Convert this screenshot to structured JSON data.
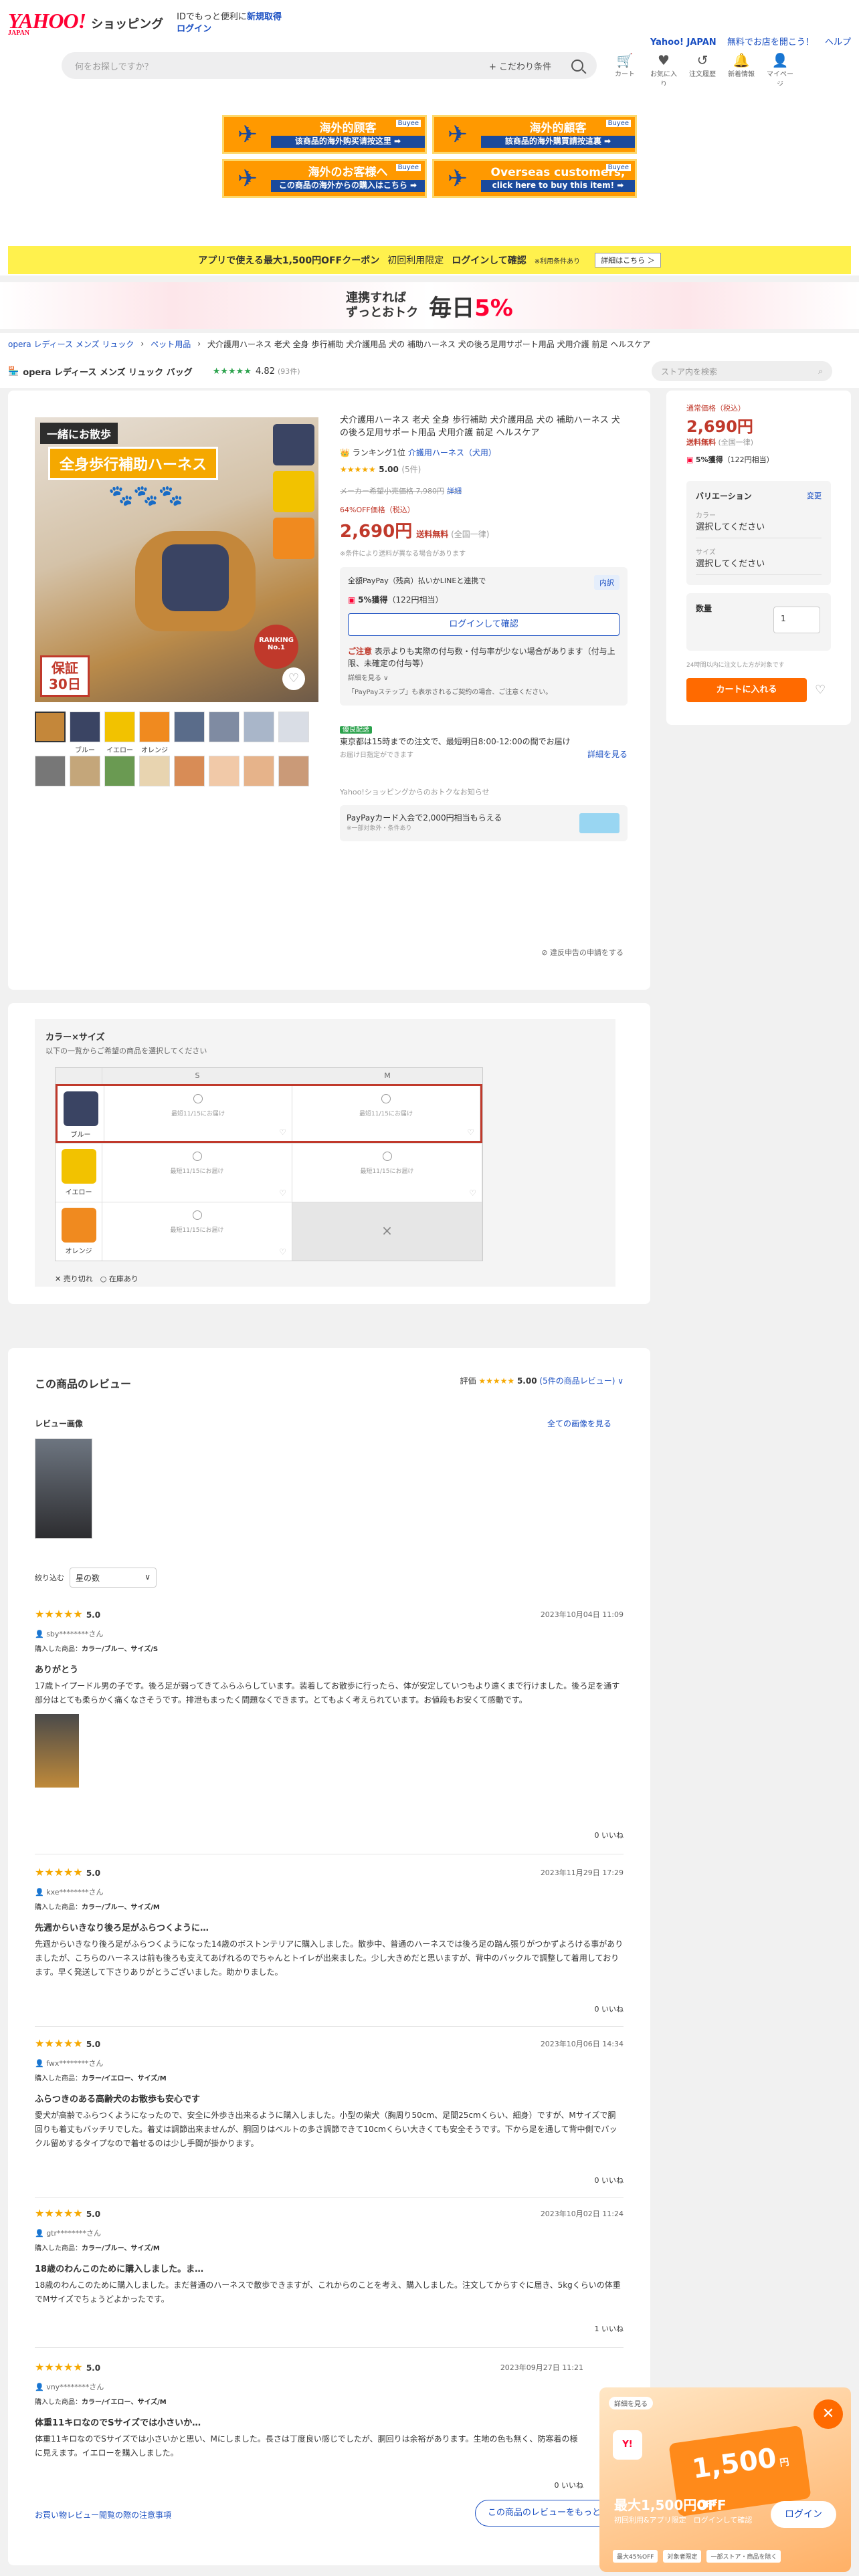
{
  "header": {
    "logo_main": "YAHOO!",
    "logo_sub": "JAPAN",
    "shopping": "ショッピング",
    "promo_line1": "IDでもっと便利に",
    "promo_link": "新規取得",
    "promo_login": "ログイン",
    "right_brand": "Yahoo! JAPAN",
    "right_link1": "無料でお店を開こう！",
    "right_link2": "ヘルプ",
    "search_placeholder": "何をお探しですか？",
    "search_filter": "+ こだわり条件",
    "icons": [
      {
        "icon": "cart-icon",
        "label": "カート"
      },
      {
        "icon": "heart-icon",
        "label": "お気に入り"
      },
      {
        "icon": "history-icon",
        "label": "注文履歴"
      },
      {
        "icon": "bell-icon",
        "label": "新着情報"
      },
      {
        "icon": "user-icon",
        "label": "マイページ"
      }
    ]
  },
  "ads": [
    {
      "t1": "海外的顾客",
      "t2": "该商品的海外购买请按这里 ➡",
      "badge": "Buyee"
    },
    {
      "t1": "海外的顧客",
      "t2": "該商品的海外購買請按這裏 ➡",
      "badge": "Buyee"
    },
    {
      "t1": "海外のお客様へ",
      "t2": "この商品の海外からの購入はこちら ➡",
      "badge": "Buyee"
    },
    {
      "t1": "Overseas customers,",
      "t2": "click here to buy this item! ➡",
      "badge": "Buyee"
    }
  ],
  "coupon": {
    "text1": "アプリで使える最大1,500円OFFクーポン",
    "text2": "初回利用限定",
    "text3": "ログインして確認",
    "small": "※利用条件あり",
    "btn": "詳細はこちら ＞"
  },
  "banner": {
    "txt1": "連携すれば",
    "txt2": "ずっとおトク",
    "big1": "毎日",
    "big2": "5%"
  },
  "breadcrumb": [
    "opera レディース メンズ リュック",
    "ペット用品",
    "犬介護用ハーネス 老犬 全身 歩行補助 犬介護用品 犬の 補助ハーネス 犬の後ろ足用サポート用品 犬用介護 前足 ヘルスケア"
  ],
  "store": {
    "name": "opera レディース メンズ リュック バッグ",
    "stars": "★★★★★",
    "rating": "4.82",
    "count": "(93件)",
    "search_placeholder": "ストア内を検索"
  },
  "product": {
    "image_banner1": "一緒にお散歩",
    "image_banner2": "全身歩行補助ハーネス",
    "image_paws": "🐾🐾🐾",
    "image_guarantee": "保証\n30日",
    "image_ranking": "RANKING\nNo.1",
    "thumb_labels": [
      "",
      "ブルー",
      "イエロー",
      "オレンジ"
    ],
    "title": "犬介護用ハーネス 老犬 全身 歩行補助 犬介護用品 犬の 補助ハーネス 犬の後ろ足用サポート用品 犬用介護 前足 ヘルスケア",
    "rank_text": "ランキング1位",
    "rank_link": "介護用ハーネス（犬用）",
    "stars": "★★★★★",
    "rating": "5.00",
    "review_count": "(5件)",
    "strike_price": "メーカー希望小売価格 7,980円",
    "strike_link": "詳細",
    "off": "64%OFF価格（税込）",
    "price": "2,690円",
    "price_ship": "送料無料",
    "price_ship_note": "(全国一律)",
    "note": "※条件により送料が異なる場合があります",
    "pay_line": "全額PayPay（残高）払いかLINEと連携で",
    "pay_naiyaku": "内訳",
    "pay_points": "5%獲得",
    "pay_points_sub": "（122円相当）",
    "login_btn": "ログインして確認",
    "caution_head": "ご注意",
    "caution": "表示よりも実際の付与数・付与率が少ない場合があります（付与上限、未確定の付与等）",
    "caution_more": "詳細を見る ∨",
    "caution_small": "「PayPayステップ」も表示されるご契約の場合、ご注意ください。",
    "ship_tag": "優良配送",
    "ship_line": "東京都は15時までの注文で、最短明日8:00-12:00の間でお届け",
    "ship_sub": "お届け日指定ができます",
    "ship_link": "詳細を見る",
    "pp_head": "Yahoo!ショッピングからのおトクなお知らせ",
    "pp_line": "PayPayカード入会で2,000円相当もらえる",
    "pp_sub": "※一部対象外・条件あり",
    "report": "⊘ 違反申告の申請をする"
  },
  "side": {
    "label": "通常価格（税込）",
    "price": "2,690円",
    "ship": "送料無料",
    "ship_note": "(全国一律)",
    "points": "5%獲得",
    "points_sub": "（122円相当）",
    "var_title": "バリエーション",
    "var_change": "変更",
    "k1": "カラー",
    "v1": "選択してください",
    "k2": "サイズ",
    "v2": "選択してください",
    "qty_label": "数量",
    "qty_value": "1",
    "small": "24時間以内に注文した方が対象です",
    "cart": "カートに入れる"
  },
  "colorsize": {
    "title": "カラー×サイズ",
    "sub": "以下の一覧からご希望の商品を選択してください",
    "sizes": [
      "S",
      "M"
    ],
    "rows": [
      {
        "color": "ブルー",
        "cells": [
          "最短11/15にお届け",
          "最短11/15にお届け"
        ]
      },
      {
        "color": "イエロー",
        "cells": [
          "最短11/15にお届け",
          "最短11/15にお届け"
        ]
      },
      {
        "color": "オレンジ",
        "cells": [
          "最短11/15にお届け",
          "×"
        ]
      }
    ],
    "legend1": "✕ 売り切れ",
    "legend2": "○ 在庫あり"
  },
  "reviews": {
    "title": "この商品のレビュー",
    "score_label": "評価",
    "score_stars": "★★★★★",
    "score": "5.00",
    "score_link": "(5件の商品レビュー) ∨",
    "images_label": "レビュー画像",
    "all_images": "全ての画像を見る",
    "filter_label": "絞り込む",
    "filter_value": "星の数",
    "items": [
      {
        "stars": "★★★★★",
        "score": "5.0",
        "date": "2023年10月04日 11:09",
        "user": "sby********さん",
        "bought_label": "購入した商品：",
        "bought": "カラー/ブルー、サイズ/S",
        "title": "ありがとう",
        "body": "17歳トイプードル男の子です。後ろ足が弱ってきてふらふらしています。装着してお散歩に行ったら、体が安定していつもより遠くまで行けました。後ろ足を通す部分はとても柔らかく痛くなさそうです。排泄もまったく問題なくできます。とてもよく考えられています。お値段もお安くて感動です。",
        "likes": "0 いいね"
      },
      {
        "stars": "★★★★★",
        "score": "5.0",
        "date": "2023年11月29日 17:29",
        "user": "kxe********さん",
        "bought_label": "購入した商品：",
        "bought": "カラー/ブルー、サイズ/M",
        "title": "先週からいきなり後ろ足がふらつくように…",
        "body": "先週からいきなり後ろ足がふらつくようになった14歳のボストンテリアに購入しました。散歩中、普通のハーネスでは後ろ足の踏ん張りがつかずよろける事がありましたが、こちらのハーネスは前も後ろも支えてあげれるのでちゃんとトイレが出来ました。少し大きめだと思いますが、背中のバックルで調整して着用しております。早く発送して下さりありがとうございました。助かりました。",
        "likes": "0 いいね"
      },
      {
        "stars": "★★★★★",
        "score": "5.0",
        "date": "2023年10月06日 14:34",
        "user": "fwx********さん",
        "bought_label": "購入した商品：",
        "bought": "カラー/イエロー、サイズ/M",
        "title": "ふらつきのある高齢犬のお散歩も安心です",
        "body": "愛犬が高齢でふらつくようになったので、安全に外歩き出来るように購入しました。小型の柴犬（胸周り50cm、足間25cmくらい、細身）ですが、Mサイズで胴回りも着丈もバッチリでした。着丈は調節出来ませんが、胴回りはベルトの多さ調節できて10cmくらい大きくても安全そうです。下から足を通して背中側でバックル留めするタイプなので着せるのは少し手間が掛かります。",
        "likes": "0 いいね"
      },
      {
        "stars": "★★★★★",
        "score": "5.0",
        "date": "2023年10月02日 11:24",
        "user": "gtr********さん",
        "bought_label": "購入した商品：",
        "bought": "カラー/ブルー、サイズ/M",
        "title": "18歳のわんこのために購入しました。ま…",
        "body": "18歳のわんこのために購入しました。まだ普通のハーネスで散歩できますが、これからのことを考え、購入しました。注文してからすぐに届き、5kgくらいの体重でMサイズでちょうどよかったです。",
        "likes": "1 いいね"
      },
      {
        "stars": "★★★★★",
        "score": "5.0",
        "date": "2023年09月27日 11:21",
        "user": "vny********さん",
        "bought_label": "購入した商品：",
        "bought": "カラー/イエロー、サイズ/M",
        "title": "体重11キロなのでSサイズでは小さいか…",
        "body": "体重11キロなのでSサイズでは小さいかと思い、Mにしました。長さは丁度良い感じでしたが、胴回りは余裕があります。生地の色も無く、防寒着の様に見えます。イエローを購入しました。",
        "likes": "0 いいね"
      }
    ],
    "foot_link": "お買い物レビュー閲覧の際の注意事項",
    "more_btn": "この商品のレビューをもっと見る"
  },
  "popup": {
    "chip": "詳細を見る",
    "coupon_amount": "1,500",
    "coupon_unit": "円OFF",
    "max_line": "最大1,500円OFF",
    "sub_line": "初回利用&アプリ限定　ログインして確認",
    "login": "ログイン",
    "tags": [
      "最大45%OFF",
      "対象者限定",
      "一部ストア・商品を除く"
    ],
    "close": "✕"
  },
  "colors": {
    "accent": "#ff0033",
    "link": "#1a4fc2",
    "price": "#c0392b",
    "cart": "#ff6a00",
    "coupon_bg": "#fff14d"
  }
}
